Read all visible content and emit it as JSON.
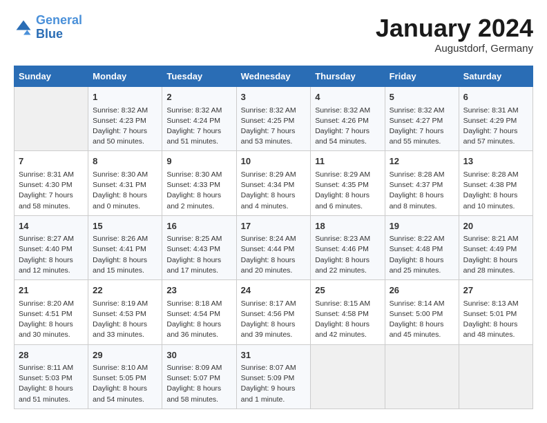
{
  "header": {
    "logo_line1": "General",
    "logo_line2": "Blue",
    "month": "January 2024",
    "location": "Augustdorf, Germany"
  },
  "weekdays": [
    "Sunday",
    "Monday",
    "Tuesday",
    "Wednesday",
    "Thursday",
    "Friday",
    "Saturday"
  ],
  "weeks": [
    [
      {
        "day": "",
        "content": ""
      },
      {
        "day": "1",
        "content": "Sunrise: 8:32 AM\nSunset: 4:23 PM\nDaylight: 7 hours\nand 50 minutes."
      },
      {
        "day": "2",
        "content": "Sunrise: 8:32 AM\nSunset: 4:24 PM\nDaylight: 7 hours\nand 51 minutes."
      },
      {
        "day": "3",
        "content": "Sunrise: 8:32 AM\nSunset: 4:25 PM\nDaylight: 7 hours\nand 53 minutes."
      },
      {
        "day": "4",
        "content": "Sunrise: 8:32 AM\nSunset: 4:26 PM\nDaylight: 7 hours\nand 54 minutes."
      },
      {
        "day": "5",
        "content": "Sunrise: 8:32 AM\nSunset: 4:27 PM\nDaylight: 7 hours\nand 55 minutes."
      },
      {
        "day": "6",
        "content": "Sunrise: 8:31 AM\nSunset: 4:29 PM\nDaylight: 7 hours\nand 57 minutes."
      }
    ],
    [
      {
        "day": "7",
        "content": "Sunrise: 8:31 AM\nSunset: 4:30 PM\nDaylight: 7 hours\nand 58 minutes."
      },
      {
        "day": "8",
        "content": "Sunrise: 8:30 AM\nSunset: 4:31 PM\nDaylight: 8 hours\nand 0 minutes."
      },
      {
        "day": "9",
        "content": "Sunrise: 8:30 AM\nSunset: 4:33 PM\nDaylight: 8 hours\nand 2 minutes."
      },
      {
        "day": "10",
        "content": "Sunrise: 8:29 AM\nSunset: 4:34 PM\nDaylight: 8 hours\nand 4 minutes."
      },
      {
        "day": "11",
        "content": "Sunrise: 8:29 AM\nSunset: 4:35 PM\nDaylight: 8 hours\nand 6 minutes."
      },
      {
        "day": "12",
        "content": "Sunrise: 8:28 AM\nSunset: 4:37 PM\nDaylight: 8 hours\nand 8 minutes."
      },
      {
        "day": "13",
        "content": "Sunrise: 8:28 AM\nSunset: 4:38 PM\nDaylight: 8 hours\nand 10 minutes."
      }
    ],
    [
      {
        "day": "14",
        "content": "Sunrise: 8:27 AM\nSunset: 4:40 PM\nDaylight: 8 hours\nand 12 minutes."
      },
      {
        "day": "15",
        "content": "Sunrise: 8:26 AM\nSunset: 4:41 PM\nDaylight: 8 hours\nand 15 minutes."
      },
      {
        "day": "16",
        "content": "Sunrise: 8:25 AM\nSunset: 4:43 PM\nDaylight: 8 hours\nand 17 minutes."
      },
      {
        "day": "17",
        "content": "Sunrise: 8:24 AM\nSunset: 4:44 PM\nDaylight: 8 hours\nand 20 minutes."
      },
      {
        "day": "18",
        "content": "Sunrise: 8:23 AM\nSunset: 4:46 PM\nDaylight: 8 hours\nand 22 minutes."
      },
      {
        "day": "19",
        "content": "Sunrise: 8:22 AM\nSunset: 4:48 PM\nDaylight: 8 hours\nand 25 minutes."
      },
      {
        "day": "20",
        "content": "Sunrise: 8:21 AM\nSunset: 4:49 PM\nDaylight: 8 hours\nand 28 minutes."
      }
    ],
    [
      {
        "day": "21",
        "content": "Sunrise: 8:20 AM\nSunset: 4:51 PM\nDaylight: 8 hours\nand 30 minutes."
      },
      {
        "day": "22",
        "content": "Sunrise: 8:19 AM\nSunset: 4:53 PM\nDaylight: 8 hours\nand 33 minutes."
      },
      {
        "day": "23",
        "content": "Sunrise: 8:18 AM\nSunset: 4:54 PM\nDaylight: 8 hours\nand 36 minutes."
      },
      {
        "day": "24",
        "content": "Sunrise: 8:17 AM\nSunset: 4:56 PM\nDaylight: 8 hours\nand 39 minutes."
      },
      {
        "day": "25",
        "content": "Sunrise: 8:15 AM\nSunset: 4:58 PM\nDaylight: 8 hours\nand 42 minutes."
      },
      {
        "day": "26",
        "content": "Sunrise: 8:14 AM\nSunset: 5:00 PM\nDaylight: 8 hours\nand 45 minutes."
      },
      {
        "day": "27",
        "content": "Sunrise: 8:13 AM\nSunset: 5:01 PM\nDaylight: 8 hours\nand 48 minutes."
      }
    ],
    [
      {
        "day": "28",
        "content": "Sunrise: 8:11 AM\nSunset: 5:03 PM\nDaylight: 8 hours\nand 51 minutes."
      },
      {
        "day": "29",
        "content": "Sunrise: 8:10 AM\nSunset: 5:05 PM\nDaylight: 8 hours\nand 54 minutes."
      },
      {
        "day": "30",
        "content": "Sunrise: 8:09 AM\nSunset: 5:07 PM\nDaylight: 8 hours\nand 58 minutes."
      },
      {
        "day": "31",
        "content": "Sunrise: 8:07 AM\nSunset: 5:09 PM\nDaylight: 9 hours\nand 1 minute."
      },
      {
        "day": "",
        "content": ""
      },
      {
        "day": "",
        "content": ""
      },
      {
        "day": "",
        "content": ""
      }
    ]
  ]
}
